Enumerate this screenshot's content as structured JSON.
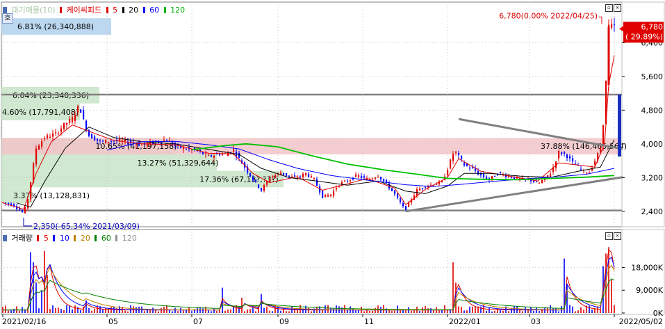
{
  "price_legend": {
    "items": [
      {
        "text": "대기매물(10)",
        "color": "#a8c8a8"
      },
      {
        "text": "케이씨피드",
        "color": "#e00000"
      },
      {
        "text": "5",
        "color": "#e00000"
      },
      {
        "text": "20",
        "color": "#000000"
      },
      {
        "text": "60",
        "color": "#0000ff"
      },
      {
        "text": "120",
        "color": "#00b000"
      }
    ]
  },
  "volume_legend": {
    "items": [
      {
        "text": "거래량",
        "color": "#000000"
      },
      {
        "text": "5",
        "color": "#e00000"
      },
      {
        "text": "10",
        "color": "#0000ff"
      },
      {
        "text": "20",
        "color": "#c08000"
      },
      {
        "text": "60",
        "color": "#008000"
      },
      {
        "text": "120",
        "color": "#909090"
      }
    ]
  },
  "left_badge": "호",
  "price_axis": {
    "ticks": [
      {
        "label": "6,400",
        "value": 6400
      },
      {
        "label": "5,600",
        "value": 5600
      },
      {
        "label": "4,800",
        "value": 4800
      },
      {
        "label": "4,000",
        "value": 4000
      },
      {
        "label": "3,200",
        "value": 3200
      },
      {
        "label": "2,400",
        "value": 2400
      }
    ],
    "current_badge": {
      "line1": "6,780",
      "line2": "( 29.89%)"
    }
  },
  "volume_axis": {
    "ticks": [
      {
        "label": "18,000K",
        "value": 18000
      },
      {
        "label": "9,000K",
        "value": 9000
      },
      {
        "label": "0K",
        "value": 0
      }
    ]
  },
  "x_axis": {
    "ticks": [
      {
        "label": "2021/02/16",
        "day": 0
      },
      {
        "label": "05",
        "day": 75
      },
      {
        "label": "07",
        "day": 136
      },
      {
        "label": "09",
        "day": 198
      },
      {
        "label": "11",
        "day": 259
      },
      {
        "label": "2022/01",
        "day": 320
      },
      {
        "label": "03",
        "day": 379
      },
      {
        "label": "2022/05/02",
        "day": 440
      }
    ]
  },
  "chart_data": {
    "type": "candlestick",
    "title": "케이씨피드",
    "ylim": [
      2100,
      7050
    ],
    "volume_ylim": [
      0,
      28000
    ],
    "horizontal_lines": [
      {
        "price": 5170,
        "color": "#808080"
      },
      {
        "price": 2420,
        "color": "#808080"
      }
    ],
    "supply_zones": [
      {
        "low": 6590,
        "high": 6980,
        "label": "6.81% (26,340,888)",
        "color": "#bcd8f0"
      },
      {
        "low": 4960,
        "high": 5350,
        "label": "6.04% (23,340,336)",
        "color": "#cfe8cf"
      },
      {
        "low": 4560,
        "high": 4960,
        "label": "4.60% (17,791,408)",
        "color": "#cfe8cf"
      },
      {
        "low": 3750,
        "high": 4140,
        "label": "10.65% (41,197,158)",
        "color": "#cfe8cf"
      },
      {
        "low": 3360,
        "high": 3750,
        "label": "13.27% (51,329,644)",
        "color": "#cfe8cf"
      },
      {
        "low": 2970,
        "high": 3360,
        "label": "17.36% (67,13?,?3?)",
        "color": "#cfe8cf"
      },
      {
        "low": 2590,
        "high": 2970,
        "label": "3.37% (13,128,831)",
        "color": "#cfe8cf"
      },
      {
        "low": 3750,
        "high": 4140,
        "label": "37.88% (146,465,564)",
        "color": "#f2c4c8"
      }
    ],
    "annotations": [
      {
        "text": "6,780(0.00% 2022/04/25)",
        "day": 429,
        "price": 6780,
        "color": "#e00000"
      },
      {
        "text": "2,350(-65.34% 2021/03/09)",
        "day": 15,
        "price": 2350,
        "color": "#0000c0"
      }
    ],
    "trendlines": [
      {
        "from": [
          328,
          4590
        ],
        "to": [
          446,
          3880
        ]
      },
      {
        "from": [
          290,
          2400
        ],
        "to": [
          446,
          3210
        ]
      }
    ],
    "price_path": [
      [
        0,
        2610
      ],
      [
        8,
        2540
      ],
      [
        15,
        2350
      ],
      [
        18,
        2700
      ],
      [
        24,
        3900
      ],
      [
        30,
        4150
      ],
      [
        38,
        4240
      ],
      [
        45,
        4480
      ],
      [
        50,
        4600
      ],
      [
        55,
        4920
      ],
      [
        58,
        4550
      ],
      [
        62,
        4200
      ],
      [
        70,
        4050
      ],
      [
        80,
        4080
      ],
      [
        90,
        4050
      ],
      [
        100,
        3980
      ],
      [
        110,
        4050
      ],
      [
        118,
        4100
      ],
      [
        124,
        3950
      ],
      [
        132,
        3880
      ],
      [
        140,
        3830
      ],
      [
        148,
        3700
      ],
      [
        155,
        3760
      ],
      [
        160,
        3760
      ],
      [
        166,
        3850
      ],
      [
        170,
        3650
      ],
      [
        175,
        3400
      ],
      [
        180,
        3150
      ],
      [
        186,
        2900
      ],
      [
        192,
        3200
      ],
      [
        200,
        3320
      ],
      [
        206,
        3220
      ],
      [
        212,
        3200
      ],
      [
        218,
        3300
      ],
      [
        224,
        3150
      ],
      [
        230,
        2750
      ],
      [
        236,
        2800
      ],
      [
        242,
        3050
      ],
      [
        248,
        3120
      ],
      [
        255,
        3250
      ],
      [
        262,
        3150
      ],
      [
        270,
        3250
      ],
      [
        276,
        3050
      ],
      [
        282,
        2800
      ],
      [
        288,
        2500
      ],
      [
        290,
        2470
      ],
      [
        294,
        2700
      ],
      [
        298,
        2900
      ],
      [
        304,
        3000
      ],
      [
        310,
        3040
      ],
      [
        316,
        3100
      ],
      [
        320,
        3420
      ],
      [
        325,
        3850
      ],
      [
        328,
        3700
      ],
      [
        332,
        3500
      ],
      [
        338,
        3400
      ],
      [
        344,
        3250
      ],
      [
        350,
        3150
      ],
      [
        356,
        3300
      ],
      [
        362,
        3250
      ],
      [
        368,
        3200
      ],
      [
        374,
        3150
      ],
      [
        380,
        3140
      ],
      [
        385,
        3050
      ],
      [
        390,
        3180
      ],
      [
        395,
        3350
      ],
      [
        400,
        3800
      ],
      [
        405,
        3750
      ],
      [
        410,
        3550
      ],
      [
        414,
        3450
      ],
      [
        418,
        3350
      ],
      [
        422,
        3330
      ],
      [
        426,
        3600
      ],
      [
        430,
        3900
      ],
      [
        433,
        4800
      ],
      [
        436,
        6780
      ],
      [
        440,
        6780
      ]
    ],
    "moving_averages": [
      {
        "name": "5",
        "color": "#e00000",
        "points": [
          [
            0,
            2600
          ],
          [
            15,
            2450
          ],
          [
            24,
            3300
          ],
          [
            35,
            4050
          ],
          [
            50,
            4450
          ],
          [
            62,
            4300
          ],
          [
            80,
            4080
          ],
          [
            100,
            4000
          ],
          [
            124,
            3980
          ],
          [
            148,
            3780
          ],
          [
            166,
            3760
          ],
          [
            180,
            3300
          ],
          [
            192,
            3080
          ],
          [
            212,
            3220
          ],
          [
            230,
            2900
          ],
          [
            248,
            3050
          ],
          [
            262,
            3180
          ],
          [
            282,
            2950
          ],
          [
            290,
            2560
          ],
          [
            304,
            2920
          ],
          [
            320,
            3200
          ],
          [
            328,
            3650
          ],
          [
            344,
            3350
          ],
          [
            362,
            3250
          ],
          [
            385,
            3120
          ],
          [
            400,
            3550
          ],
          [
            414,
            3500
          ],
          [
            426,
            3450
          ],
          [
            433,
            4000
          ],
          [
            436,
            5400
          ],
          [
            440,
            6100
          ]
        ]
      },
      {
        "name": "20",
        "color": "#000000",
        "points": [
          [
            10,
            2600
          ],
          [
            20,
            2500
          ],
          [
            30,
            3100
          ],
          [
            45,
            3900
          ],
          [
            62,
            4400
          ],
          [
            80,
            4150
          ],
          [
            100,
            4050
          ],
          [
            124,
            4000
          ],
          [
            148,
            3870
          ],
          [
            170,
            3750
          ],
          [
            186,
            3420
          ],
          [
            206,
            3200
          ],
          [
            230,
            3100
          ],
          [
            248,
            3020
          ],
          [
            270,
            3120
          ],
          [
            290,
            2880
          ],
          [
            304,
            2820
          ],
          [
            320,
            3000
          ],
          [
            332,
            3300
          ],
          [
            350,
            3300
          ],
          [
            374,
            3230
          ],
          [
            395,
            3210
          ],
          [
            414,
            3350
          ],
          [
            430,
            3450
          ],
          [
            440,
            4100
          ]
        ]
      },
      {
        "name": "60",
        "color": "#0000ff",
        "points": [
          [
            75,
            3850
          ],
          [
            100,
            4050
          ],
          [
            124,
            4060
          ],
          [
            148,
            3980
          ],
          [
            170,
            3880
          ],
          [
            192,
            3620
          ],
          [
            212,
            3420
          ],
          [
            236,
            3250
          ],
          [
            262,
            3140
          ],
          [
            290,
            3030
          ],
          [
            310,
            2990
          ],
          [
            330,
            3040
          ],
          [
            356,
            3120
          ],
          [
            380,
            3180
          ],
          [
            400,
            3220
          ],
          [
            420,
            3280
          ],
          [
            440,
            3420
          ]
        ]
      },
      {
        "name": "120",
        "color": "#00c000",
        "points": [
          [
            136,
            3860
          ],
          [
            160,
            3960
          ],
          [
            175,
            4000
          ],
          [
            198,
            3930
          ],
          [
            222,
            3720
          ],
          [
            248,
            3520
          ],
          [
            275,
            3380
          ],
          [
            298,
            3280
          ],
          [
            320,
            3180
          ],
          [
            345,
            3160
          ],
          [
            370,
            3150
          ],
          [
            395,
            3180
          ],
          [
            420,
            3210
          ],
          [
            440,
            3250
          ]
        ]
      }
    ],
    "volume_spikes": [
      {
        "day": 20,
        "value": 24000
      },
      {
        "day": 22,
        "value": 20000
      },
      {
        "day": 24,
        "value": 12000
      },
      {
        "day": 28,
        "value": 9000
      },
      {
        "day": 31,
        "value": 24500
      },
      {
        "day": 33,
        "value": 15000
      },
      {
        "day": 60,
        "value": 5000
      },
      {
        "day": 158,
        "value": 10000
      },
      {
        "day": 173,
        "value": 6000
      },
      {
        "day": 186,
        "value": 7500
      },
      {
        "day": 325,
        "value": 20000
      },
      {
        "day": 327,
        "value": 12000
      },
      {
        "day": 405,
        "value": 21500
      },
      {
        "day": 406,
        "value": 11000
      },
      {
        "day": 432,
        "value": 18500
      },
      {
        "day": 434,
        "value": 23500
      },
      {
        "day": 436,
        "value": 26000
      },
      {
        "day": 438,
        "value": 13000
      }
    ]
  }
}
